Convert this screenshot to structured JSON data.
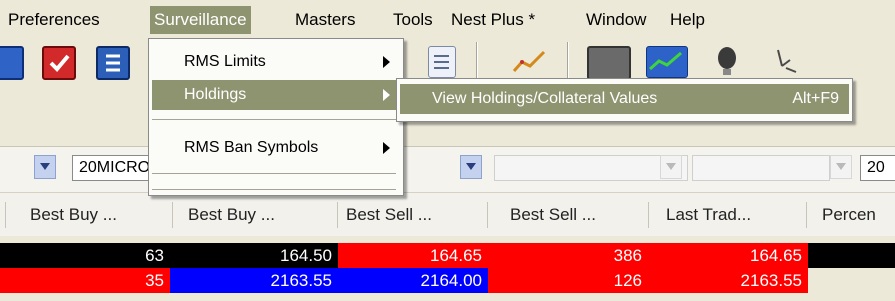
{
  "menubar": {
    "items": [
      "Preferences",
      "Surveillance",
      "Masters",
      "Tools",
      "Nest Plus *",
      "Window",
      "Help"
    ],
    "active": "Surveillance"
  },
  "surveillance_menu": {
    "items": [
      {
        "label": "RMS Limits",
        "submenu": true
      },
      {
        "label": "Holdings",
        "submenu": true,
        "highlighted": true
      },
      {
        "label": "RMS Ban Symbols",
        "submenu": true
      }
    ]
  },
  "holdings_submenu": {
    "items": [
      {
        "label": "View Holdings/Collateral Values",
        "shortcut": "Alt+F9"
      }
    ]
  },
  "filters": {
    "symbol_value": "20MICRONS",
    "right_value": "20"
  },
  "grid": {
    "columns": [
      "Best Buy ...",
      "Best Buy ...",
      "Best Sell ...",
      "Best Sell ...",
      "Last Trad...",
      "Percen"
    ],
    "rows": [
      {
        "cells": [
          "63",
          "164.50",
          "164.65",
          "386",
          "164.65"
        ]
      },
      {
        "cells": [
          "35",
          "2163.55",
          "2164.00",
          "126",
          "2163.55"
        ]
      }
    ]
  },
  "colors": {
    "menu_highlight": "#8f9470",
    "row1_bg": "#000000",
    "buy_red": "#ff0000",
    "buy_blue": "#0000ff",
    "sell_red": "#ff0000",
    "text_white": "#ffffff"
  },
  "icons": [
    "monitor-icon",
    "red-check-icon",
    "export-icon",
    "document-icon",
    "chart-icon",
    "window-icon",
    "chart-green-icon",
    "bell-icon",
    "wand-icon"
  ]
}
